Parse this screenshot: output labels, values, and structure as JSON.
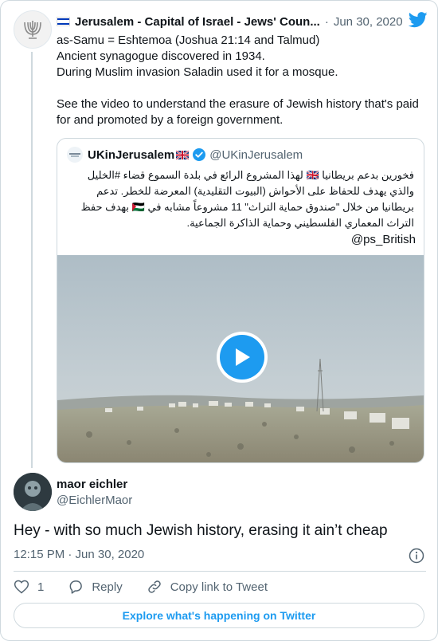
{
  "parent": {
    "author_name": "Jerusalem - Capital of Israel - Jews' Coun...",
    "date": "Jun 30, 2020",
    "dot": "·",
    "text": "as-Samu = Eshtemoa (Joshua 21:14 and Talmud)\nAncient synagogue discovered in 1934.\nDuring Muslim invasion Saladin used it for a mosque.\n\nSee the video to understand the erasure of Jewish history that's paid for and promoted by a foreign government."
  },
  "quote": {
    "author_name": "UKinJerusalem",
    "handle": "@UKinJerusalem",
    "text": "فخورين بدعم بريطانيا 🇬🇧 لهذا المشروع الرائع في بلدة السموع قضاء #الخليل والذي يهدف للحفاظ على الأحواش (البيوت التقليدية) المعرضة للخطر. تدعم بريطانيا من خلال \"صندوق حماية التراث\" 11 مشروعاً مشابه في 🇵🇸 بهدف حفظ التراث المعماري الفلسطيني وحماية الذاكرة الجماعية.",
    "tag": "@ps_British"
  },
  "reply": {
    "author_name": "maor eichler",
    "handle": "@EichlerMaor",
    "text": "Hey - with so much Jewish history, erasing it ain’t cheap",
    "time": "12:15 PM · Jun 30, 2020"
  },
  "actions": {
    "like_count": "1",
    "reply_label": "Reply",
    "copy_label": "Copy link to Tweet"
  },
  "explore_label": "Explore what's happening on Twitter",
  "colors": {
    "accent": "#1d9bf0",
    "secondary_text": "#536471",
    "border": "#cfd9de"
  },
  "icons": [
    "menorah-logo-icon",
    "israel-flag-icon",
    "twitter-bird-icon",
    "uk-flag-icon",
    "verified-badge-icon",
    "play-icon",
    "info-icon",
    "heart-icon",
    "reply-icon",
    "link-icon"
  ]
}
